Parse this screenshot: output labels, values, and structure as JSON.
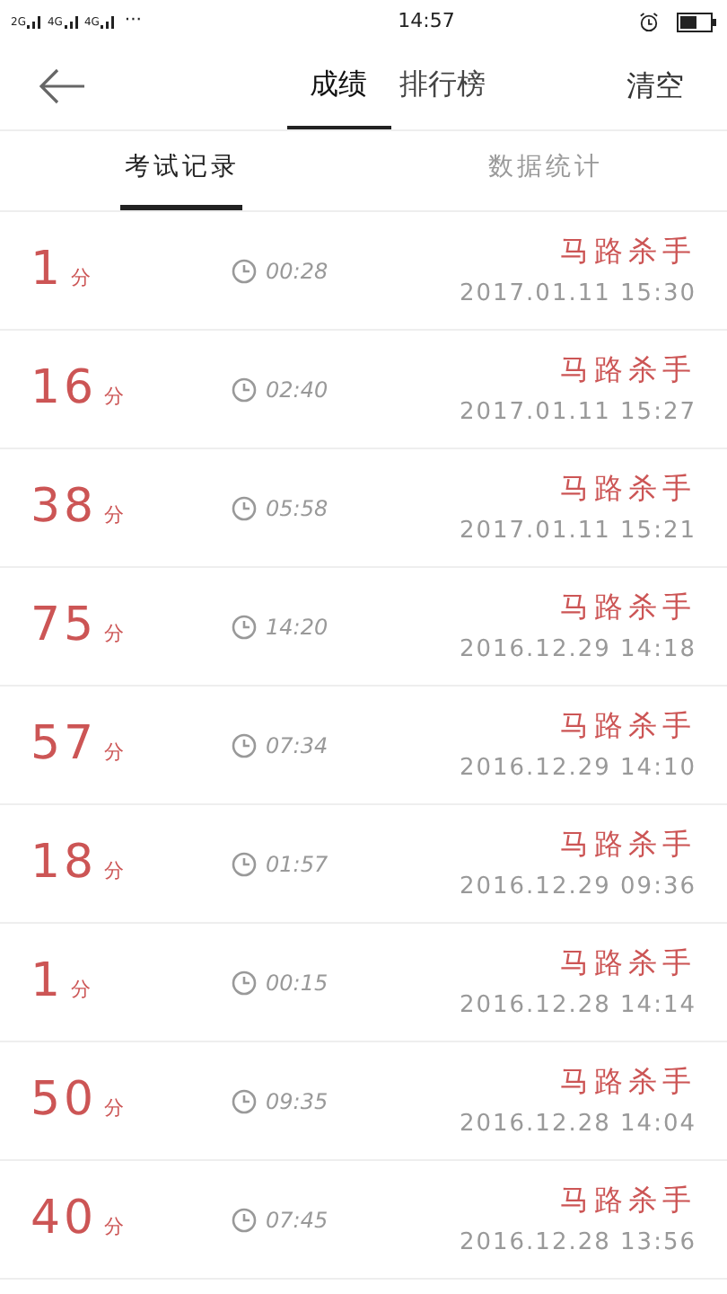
{
  "status_bar": {
    "networks": [
      "2G",
      "4G",
      "4G"
    ],
    "more": "···",
    "time": "14:57"
  },
  "nav": {
    "tabs": [
      {
        "label": "成绩",
        "selected": true
      },
      {
        "label": "排行榜",
        "selected": false
      }
    ],
    "action": "清空"
  },
  "sub_tabs": [
    {
      "label": "考试记录",
      "selected": true
    },
    {
      "label": "数据统计",
      "selected": false
    }
  ],
  "records": [
    {
      "score": "1",
      "unit": "分",
      "duration": "00:28",
      "title": "马路杀手",
      "date": "2017.01.11 15:30"
    },
    {
      "score": "16",
      "unit": "分",
      "duration": "02:40",
      "title": "马路杀手",
      "date": "2017.01.11 15:27"
    },
    {
      "score": "38",
      "unit": "分",
      "duration": "05:58",
      "title": "马路杀手",
      "date": "2017.01.11 15:21"
    },
    {
      "score": "75",
      "unit": "分",
      "duration": "14:20",
      "title": "马路杀手",
      "date": "2016.12.29 14:18"
    },
    {
      "score": "57",
      "unit": "分",
      "duration": "07:34",
      "title": "马路杀手",
      "date": "2016.12.29 14:10"
    },
    {
      "score": "18",
      "unit": "分",
      "duration": "01:57",
      "title": "马路杀手",
      "date": "2016.12.29 09:36"
    },
    {
      "score": "1",
      "unit": "分",
      "duration": "00:15",
      "title": "马路杀手",
      "date": "2016.12.28 14:14"
    },
    {
      "score": "50",
      "unit": "分",
      "duration": "09:35",
      "title": "马路杀手",
      "date": "2016.12.28 14:04"
    },
    {
      "score": "40",
      "unit": "分",
      "duration": "07:45",
      "title": "马路杀手",
      "date": "2016.12.28 13:56"
    }
  ]
}
